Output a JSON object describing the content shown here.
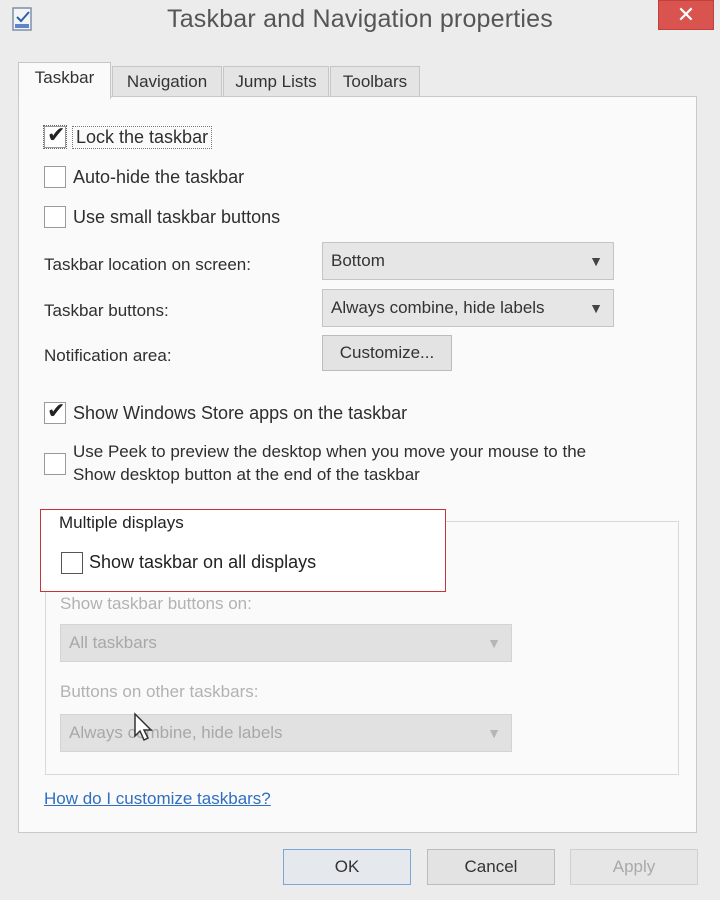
{
  "window": {
    "title": "Taskbar and Navigation properties",
    "close_label": "✕"
  },
  "tabs": [
    {
      "label": "Taskbar",
      "active": true
    },
    {
      "label": "Navigation",
      "active": false
    },
    {
      "label": "Jump Lists",
      "active": false
    },
    {
      "label": "Toolbars",
      "active": false
    }
  ],
  "taskbar": {
    "lock": {
      "label": "Lock the taskbar",
      "checked": true
    },
    "autohide": {
      "label": "Auto-hide the taskbar",
      "checked": false
    },
    "small_buttons": {
      "label": "Use small taskbar buttons",
      "checked": false
    },
    "location_label": "Taskbar location on screen:",
    "location_value": "Bottom",
    "buttons_label": "Taskbar buttons:",
    "buttons_value": "Always combine, hide labels",
    "notification_label": "Notification area:",
    "customize_label": "Customize...",
    "store_apps": {
      "label": "Show Windows Store apps on the taskbar",
      "checked": true
    },
    "peek": {
      "label_line1": "Use Peek to preview the desktop when you move your mouse to the",
      "label_line2": "Show desktop button at the end of the taskbar",
      "checked": false
    }
  },
  "multiple_displays": {
    "legend": "Multiple displays",
    "show_all": {
      "label": "Show taskbar on all displays",
      "checked": false
    },
    "show_buttons_on_label": "Show taskbar buttons on:",
    "show_buttons_on_value": "All taskbars",
    "other_buttons_label": "Buttons on other taskbars:",
    "other_buttons_value": "Always combine, hide labels"
  },
  "help_link": "How do I customize taskbars?",
  "footer": {
    "ok": "OK",
    "cancel": "Cancel",
    "apply": "Apply"
  },
  "colors": {
    "highlight_border": "#c8323a",
    "close_button": "#d9534f",
    "link": "#2f6fc1"
  }
}
